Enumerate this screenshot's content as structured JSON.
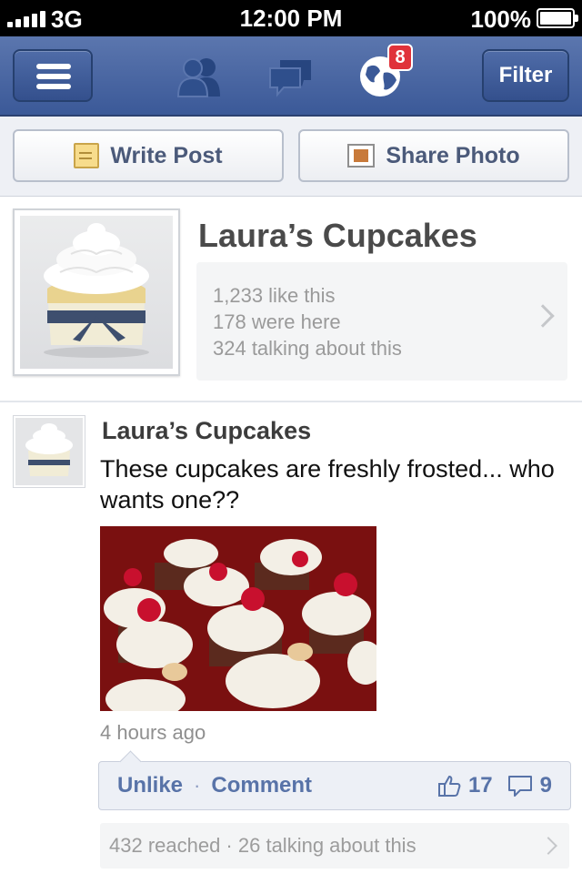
{
  "status_bar": {
    "carrier": "3G",
    "time": "12:00 PM",
    "battery": "100%"
  },
  "nav": {
    "filter_label": "Filter",
    "notification_count": "8",
    "icons": [
      "menu-icon",
      "friends-icon",
      "messages-icon",
      "globe-icon"
    ]
  },
  "composer": {
    "write_label": "Write Post",
    "photo_label": "Share Photo"
  },
  "page": {
    "name": "Laura’s Cupcakes",
    "likes": "1,233 like this",
    "checkins": "178 were here",
    "talking": "324 talking about this"
  },
  "post": {
    "author": "Laura’s Cupcakes",
    "text": "These cupcakes are freshly frosted... who wants one??",
    "time": "4 hours ago",
    "unlike_label": "Unlike",
    "separator": "·",
    "comment_label": "Comment",
    "like_count": "17",
    "comment_count": "9",
    "reach": "432 reached · 26 talking about this"
  },
  "colors": {
    "brand_blue": "#3b5998",
    "link_blue": "#5873a8",
    "badge_red": "#e0323a"
  }
}
